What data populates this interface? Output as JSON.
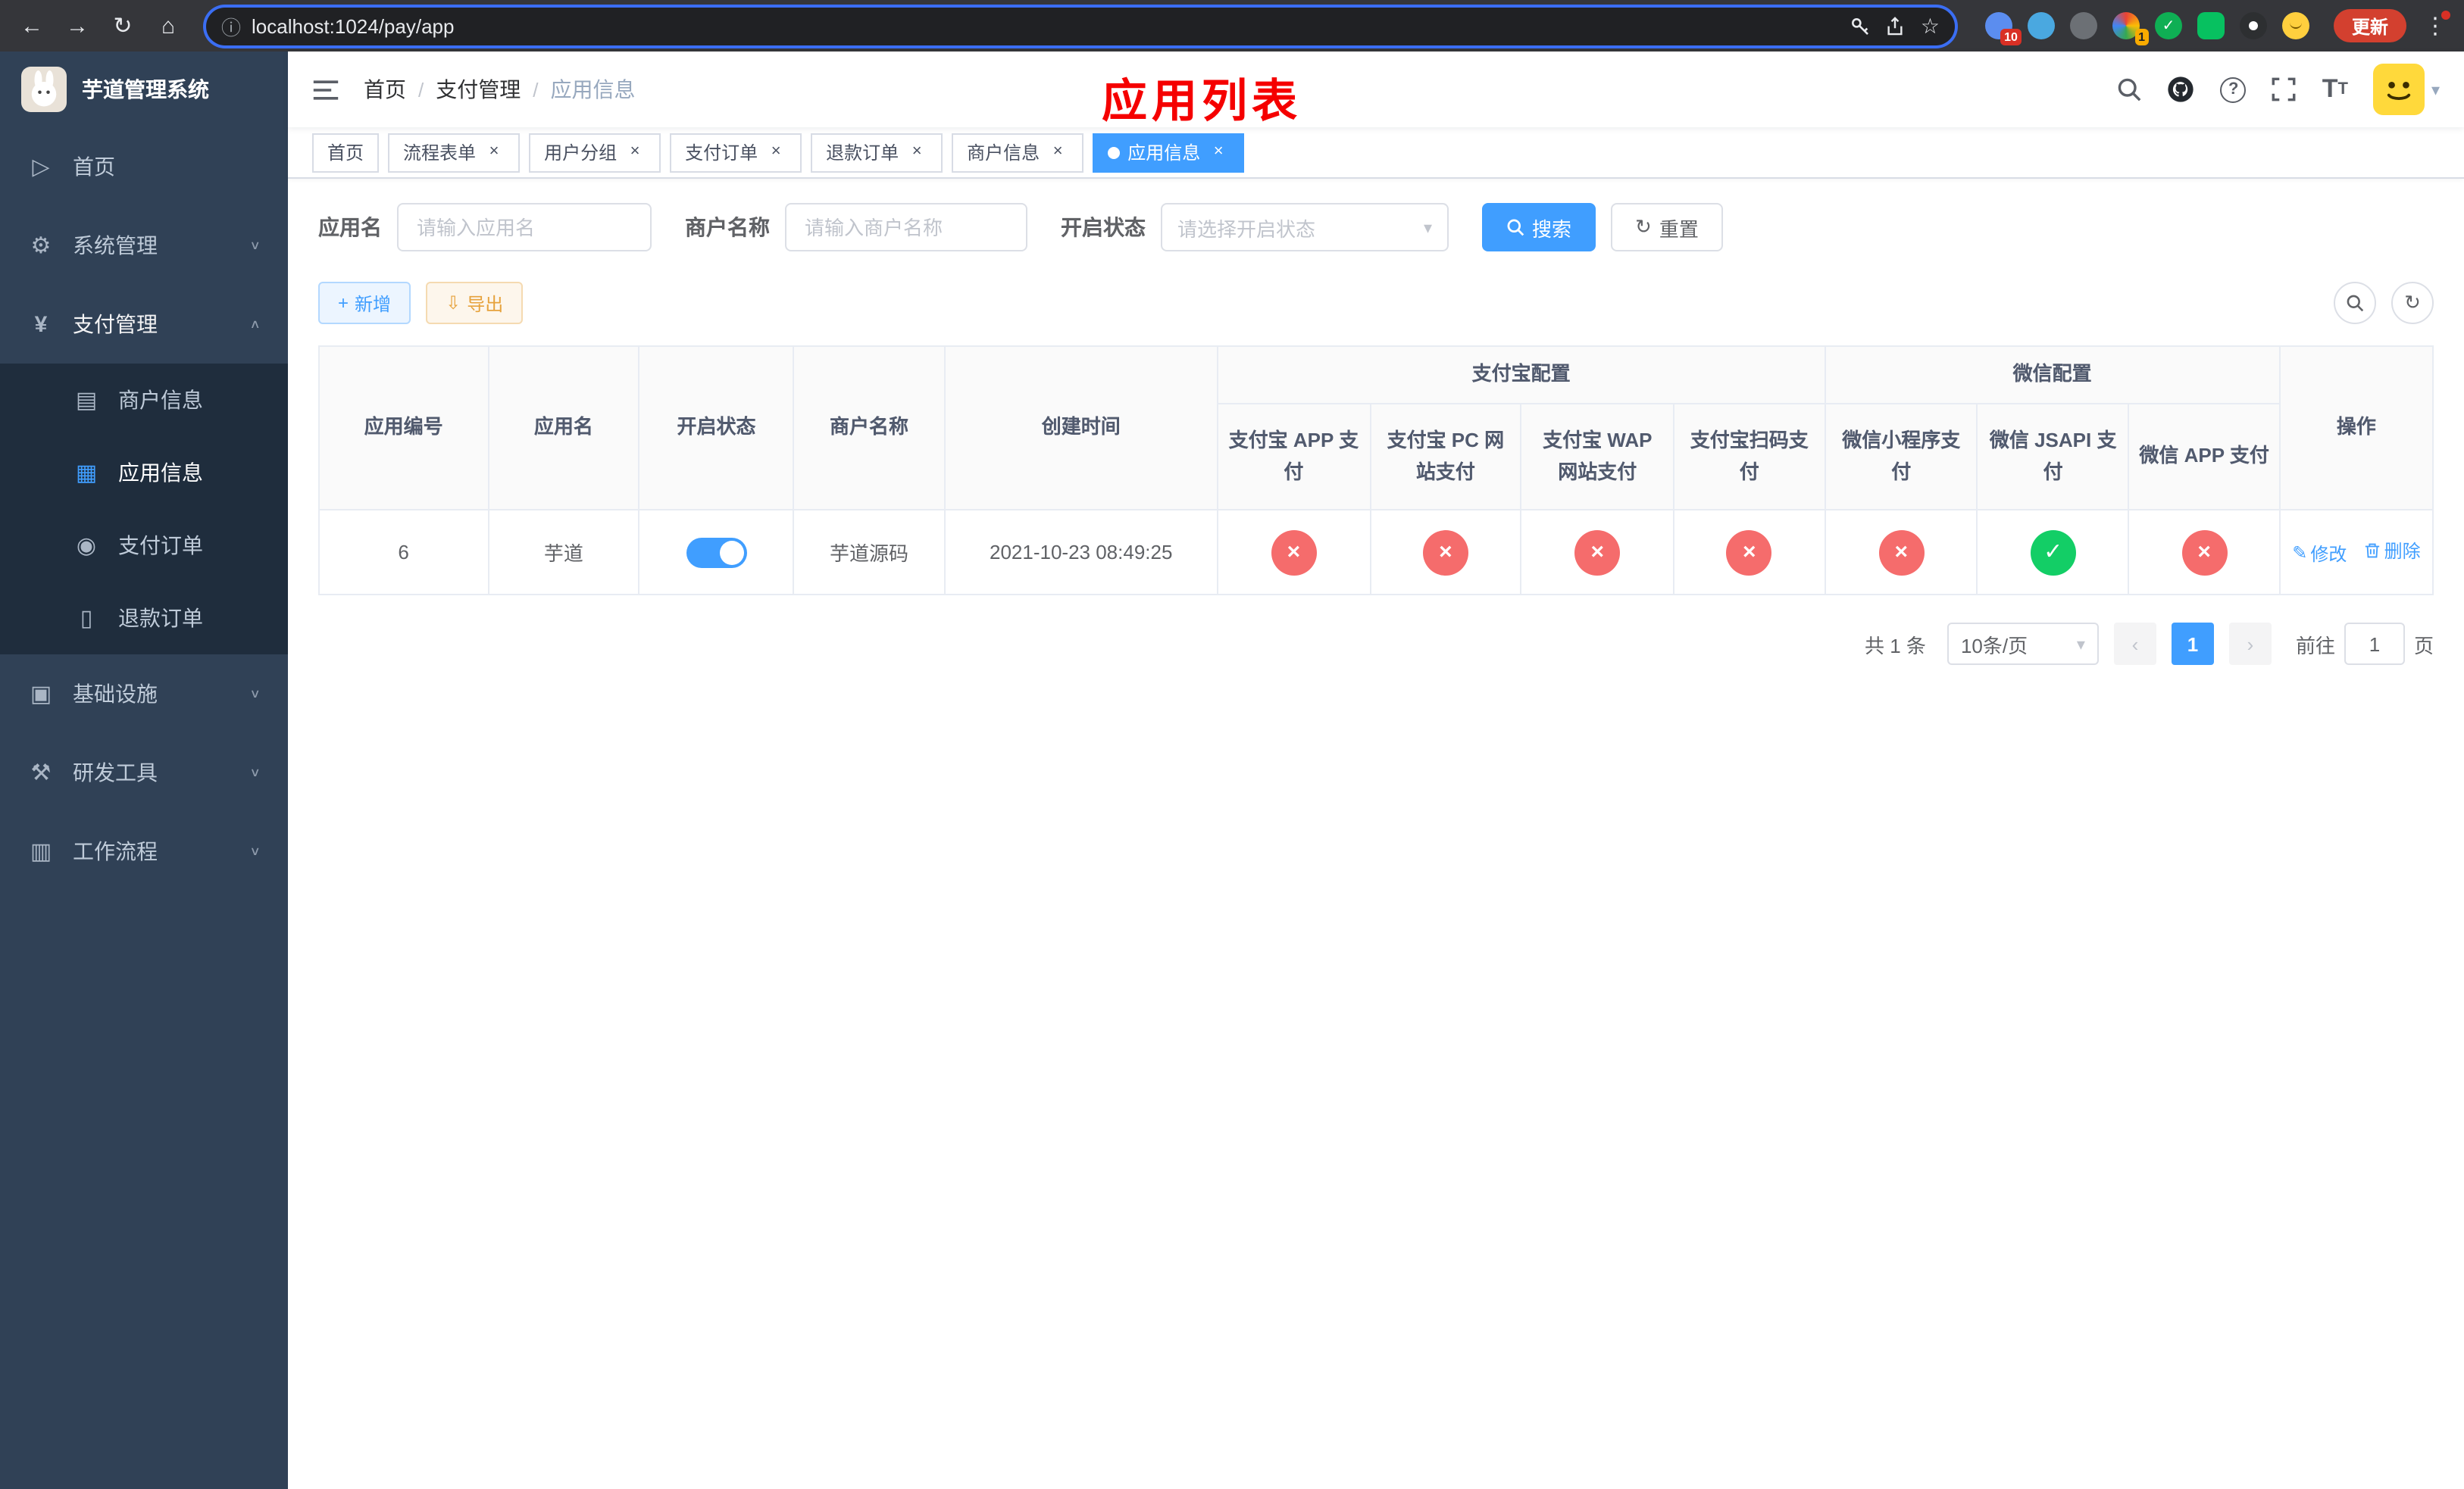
{
  "colors": {
    "primary": "#409eff",
    "ok": "#13ce66",
    "fail": "#f56c6c"
  },
  "browser": {
    "url": "localhost:1024/pay/app",
    "update_label": "更新",
    "ext_badge_first": "10",
    "ext_badge_fourth": "1"
  },
  "sidebar": {
    "title": "芋道管理系统",
    "menu": [
      {
        "label": "首页"
      },
      {
        "label": "系统管理"
      },
      {
        "label": "支付管理"
      },
      {
        "label": "基础设施"
      },
      {
        "label": "研发工具"
      },
      {
        "label": "工作流程"
      }
    ],
    "submenu": [
      {
        "label": "商户信息"
      },
      {
        "label": "应用信息"
      },
      {
        "label": "支付订单"
      },
      {
        "label": "退款订单"
      }
    ]
  },
  "navbar": {
    "breadcrumb": [
      "首页",
      "支付管理",
      "应用信息"
    ],
    "annotation": "应用列表"
  },
  "tabs": [
    {
      "label": "首页"
    },
    {
      "label": "流程表单"
    },
    {
      "label": "用户分组"
    },
    {
      "label": "支付订单"
    },
    {
      "label": "退款订单"
    },
    {
      "label": "商户信息"
    },
    {
      "label": "应用信息"
    }
  ],
  "filters": {
    "app_name_label": "应用名",
    "app_name_placeholder": "请输入应用名",
    "merchant_label": "商户名称",
    "merchant_placeholder": "请输入商户名称",
    "status_label": "开启状态",
    "status_placeholder": "请选择开启状态",
    "search_label": "搜索",
    "reset_label": "重置"
  },
  "toolbar": {
    "add_label": "新增",
    "export_label": "导出"
  },
  "table": {
    "headers": {
      "app_id": "应用编号",
      "app_name": "应用名",
      "status": "开启状态",
      "merchant": "商户名称",
      "created": "创建时间",
      "alipay_group": "支付宝配置",
      "wechat_group": "微信配置",
      "actions": "操作"
    },
    "sub_headers": [
      "支付宝 APP 支付",
      "支付宝 PC 网站支付",
      "支付宝 WAP 网站支付",
      "支付宝扫码支付",
      "微信小程序支付",
      "微信 JSAPI 支付",
      "微信 APP 支付"
    ],
    "row": {
      "app_id": "6",
      "app_name": "芋道",
      "enabled": true,
      "merchant": "芋道源码",
      "created": "2021-10-23 08:49:25",
      "pay_statuses": [
        false,
        false,
        false,
        false,
        false,
        true,
        false
      ],
      "edit_label": "修改",
      "delete_label": "删除"
    }
  },
  "pagination": {
    "total_text": "共 1 条",
    "page_size": "10条/页",
    "current_page": "1",
    "goto_label": "前往",
    "goto_value": "1",
    "page_suffix": "页"
  }
}
